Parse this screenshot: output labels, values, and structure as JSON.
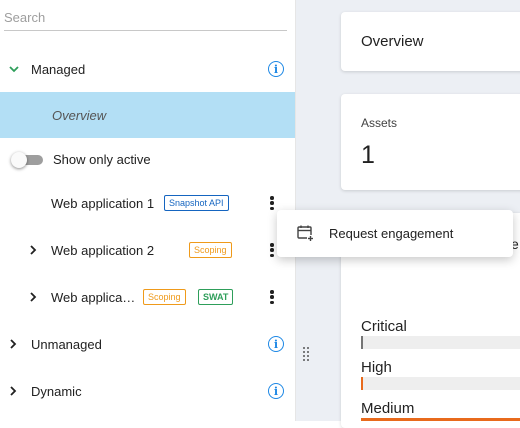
{
  "sidebar": {
    "search_placeholder": "Search",
    "managed_label": "Managed",
    "overview_label": "Overview",
    "show_only_active_label": "Show only active",
    "apps": [
      {
        "name": "Web application 1",
        "badges": [
          "Snapshot API"
        ]
      },
      {
        "name": "Web application 2",
        "badges": [
          "Scoping"
        ]
      },
      {
        "name": "Web applica…",
        "badges": [
          "Scoping",
          "SWAT"
        ]
      }
    ],
    "unmanaged_label": "Unmanaged",
    "dynamic_label": "Dynamic",
    "info_glyph": "i"
  },
  "menu": {
    "request_engagement_label": "Request engagement"
  },
  "main": {
    "overview_title": "Overview",
    "assets_label": "Assets",
    "assets_value": "1",
    "partial_char": "e",
    "severities": [
      {
        "label": "Critical",
        "level": 0
      },
      {
        "label": "High",
        "level": 0
      },
      {
        "label": "Medium",
        "level": 1
      }
    ]
  },
  "colors": {
    "accent": "#1e88e5",
    "selected_bg": "#b3dff5",
    "managed_chevron": "#2e9e5a",
    "snapshot_badge": "#1565c0",
    "scoping_badge": "#ef9a1a",
    "swat_badge": "#2e9e5a",
    "severity_bar": "#e86a1c"
  },
  "icons": [
    "chevron-down-icon",
    "chevron-right-icon",
    "info-icon",
    "more-vert-icon",
    "calendar-add-icon",
    "drag-handle-icon"
  ]
}
